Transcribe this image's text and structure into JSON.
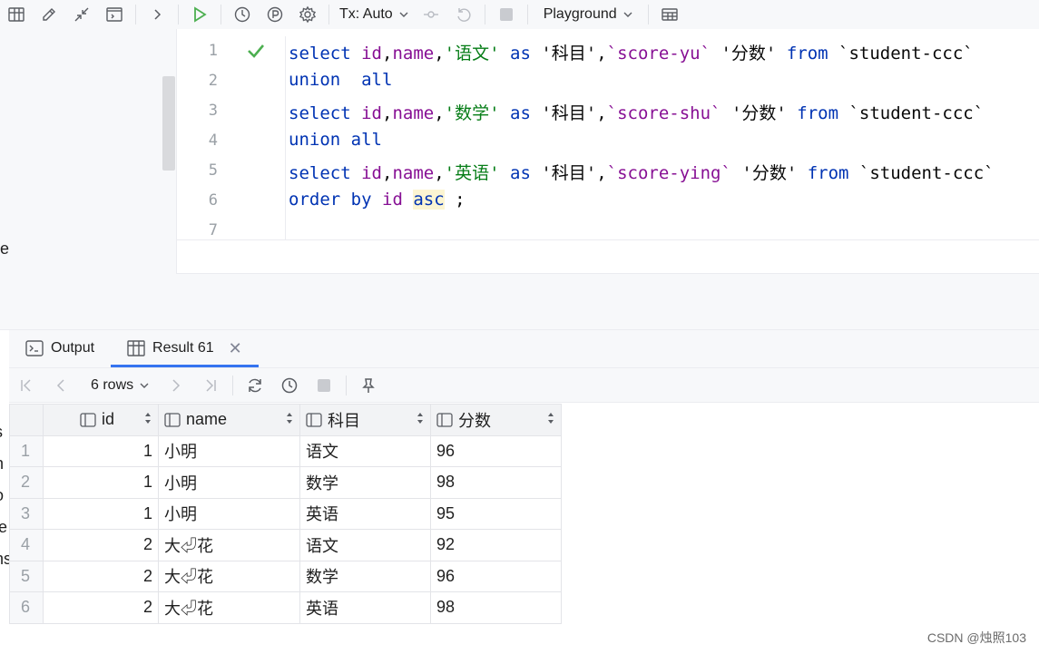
{
  "toolbar": {
    "tx_label": "Tx: Auto",
    "playground_label": "Playground"
  },
  "left_pane": {
    "cropped_text": "e",
    "cropped_lower": [
      "s",
      "n",
      "o",
      "le",
      "ns"
    ]
  },
  "editor": {
    "line_numbers": [
      "1",
      "2",
      "3",
      "4",
      "5",
      "6",
      "7"
    ],
    "lines": [
      [
        {
          "t": "select",
          "c": "kw"
        },
        {
          "t": " "
        },
        {
          "t": "id",
          "c": "fld"
        },
        {
          "t": ","
        },
        {
          "t": "name",
          "c": "fld"
        },
        {
          "t": ","
        },
        {
          "t": "'语文'",
          "c": "str"
        },
        {
          "t": " "
        },
        {
          "t": "as",
          "c": "kw"
        },
        {
          "t": " '科目',"
        },
        {
          "t": "`score-yu`",
          "c": "fld"
        },
        {
          "t": " '分数' "
        },
        {
          "t": "from",
          "c": "kw"
        },
        {
          "t": " `student-ccc`"
        }
      ],
      [
        {
          "t": "union",
          "c": "kw"
        },
        {
          "t": "  "
        },
        {
          "t": "all",
          "c": "kw"
        }
      ],
      [
        {
          "t": "select",
          "c": "kw"
        },
        {
          "t": " "
        },
        {
          "t": "id",
          "c": "fld"
        },
        {
          "t": ","
        },
        {
          "t": "name",
          "c": "fld"
        },
        {
          "t": ","
        },
        {
          "t": "'数学'",
          "c": "str"
        },
        {
          "t": " "
        },
        {
          "t": "as",
          "c": "kw"
        },
        {
          "t": " '科目',"
        },
        {
          "t": "`score-shu`",
          "c": "fld"
        },
        {
          "t": " '分数' "
        },
        {
          "t": "from",
          "c": "kw"
        },
        {
          "t": " `student-ccc`"
        }
      ],
      [
        {
          "t": "union",
          "c": "kw"
        },
        {
          "t": " "
        },
        {
          "t": "all",
          "c": "kw"
        }
      ],
      [
        {
          "t": "select",
          "c": "kw"
        },
        {
          "t": " "
        },
        {
          "t": "id",
          "c": "fld"
        },
        {
          "t": ","
        },
        {
          "t": "name",
          "c": "fld"
        },
        {
          "t": ","
        },
        {
          "t": "'英语'",
          "c": "str"
        },
        {
          "t": " "
        },
        {
          "t": "as",
          "c": "kw"
        },
        {
          "t": " '科目',"
        },
        {
          "t": "`score-ying`",
          "c": "fld"
        },
        {
          "t": " '分数' "
        },
        {
          "t": "from",
          "c": "kw"
        },
        {
          "t": " `student-ccc`"
        }
      ],
      [
        {
          "t": "order",
          "c": "kw"
        },
        {
          "t": " "
        },
        {
          "t": "by",
          "c": "kw"
        },
        {
          "t": " "
        },
        {
          "t": "id",
          "c": "fld"
        },
        {
          "t": " "
        },
        {
          "t": "asc",
          "c": "kw hl"
        },
        {
          "t": " ;"
        }
      ],
      []
    ]
  },
  "results": {
    "tabs": [
      {
        "label": "Output",
        "icon": "console-icon",
        "active": false
      },
      {
        "label": "Result 61",
        "icon": "table-icon",
        "active": true
      }
    ],
    "rows_label": "6 rows",
    "columns": [
      "id",
      "name",
      "科目",
      "分数"
    ],
    "rows": [
      [
        "1",
        "1",
        "小明",
        "语文",
        "96"
      ],
      [
        "2",
        "1",
        "小明",
        "数学",
        "98"
      ],
      [
        "3",
        "1",
        "小明",
        "英语",
        "95"
      ],
      [
        "4",
        "2",
        "大⏎花",
        "语文",
        "92"
      ],
      [
        "5",
        "2",
        "大⏎花",
        "数学",
        "96"
      ],
      [
        "6",
        "2",
        "大⏎花",
        "英语",
        "98"
      ]
    ]
  },
  "watermark": "CSDN @烛照103",
  "colors": {
    "keyword": "#0033b3",
    "string": "#067d17",
    "field": "#871094",
    "accent": "#3574f0",
    "run_green": "#4caf50"
  }
}
